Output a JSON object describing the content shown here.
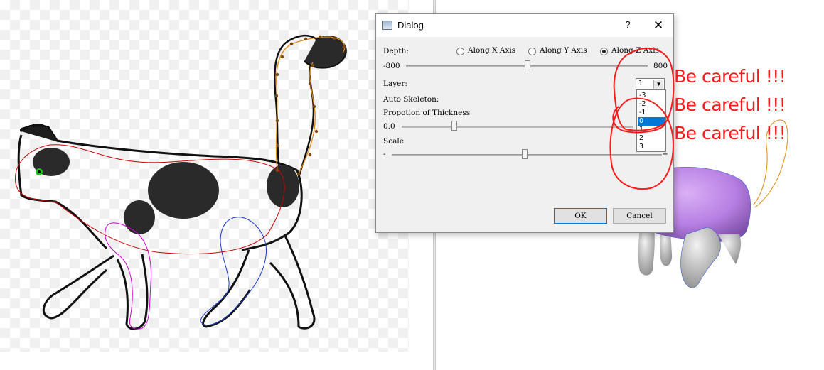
{
  "dialog": {
    "title": "Dialog",
    "help": "?",
    "close": "✕",
    "depth_label": "Depth:",
    "axis_options": [
      "Along X Axis",
      "Along Y Axis",
      "Along Z Axis"
    ],
    "selected_axis": "Along Z Axis",
    "depth_min": "-800",
    "depth_max": "800",
    "depth_value": 0,
    "layer_label": "Layer:",
    "layer_value": "1",
    "layer_options": [
      "-3",
      "-2",
      "-1",
      "0",
      "1",
      "2",
      "3"
    ],
    "layer_highlighted": "0",
    "auto_skeleton_label": "Auto Skeleton:",
    "thickness_label": "Propotion of Thickness",
    "thickness_min": "0.0",
    "scale_label": "Scale",
    "scale_min": "-",
    "scale_max": "+",
    "ok_label": "OK",
    "cancel_label": "Cancel"
  },
  "annotations": {
    "warnings": [
      "Be careful !!!",
      "Be careful !!!",
      "Be careful !!!"
    ],
    "color": "#ff1a1a"
  },
  "colors": {
    "accent": "#0078d7",
    "body_3d": "#c08ce8",
    "outline_red": "#cc0000",
    "outline_magenta": "#cc00cc",
    "outline_blue": "#1a3cc8",
    "outline_orange": "#e08a10"
  }
}
